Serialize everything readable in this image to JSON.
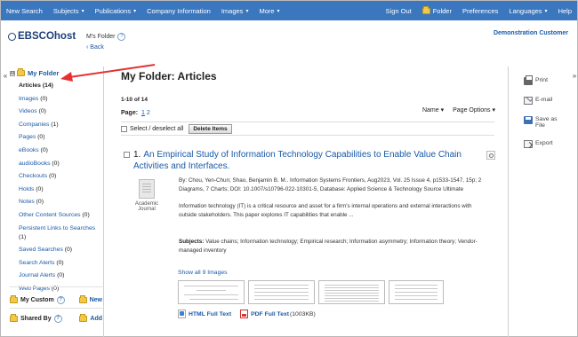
{
  "topnav": {
    "left": [
      {
        "label": "New Search",
        "caret": false
      },
      {
        "label": "Subjects",
        "caret": true
      },
      {
        "label": "Publications",
        "caret": true
      },
      {
        "label": "Company Information",
        "caret": false
      },
      {
        "label": "Images",
        "caret": true
      },
      {
        "label": "More",
        "caret": true
      }
    ],
    "right": [
      {
        "label": "Sign Out"
      },
      {
        "label": "Folder",
        "icon": "folder-icon"
      },
      {
        "label": "Preferences"
      },
      {
        "label": "Languages",
        "caret": true
      },
      {
        "label": "Help"
      }
    ]
  },
  "header": {
    "logo": "EBSCOhost",
    "folder_title": "M's Folder",
    "help": "?",
    "back": "Back",
    "institution": "Demonstration Customer"
  },
  "sidebar": {
    "root": "My Folder",
    "expand_symbol": "⊟",
    "items": [
      {
        "label": "Articles",
        "count": "(14)",
        "active": true
      },
      {
        "label": "Images",
        "count": "(0)"
      },
      {
        "label": "Videos",
        "count": "(0)"
      },
      {
        "label": "Companies",
        "count": "(1)"
      },
      {
        "label": "Pages",
        "count": "(0)"
      },
      {
        "label": "eBooks",
        "count": "(0)"
      },
      {
        "label": "audioBooks",
        "count": "(0)"
      },
      {
        "label": "Checkouts",
        "count": "(0)"
      },
      {
        "label": "Holds",
        "count": "(0)"
      },
      {
        "label": "Notes",
        "count": "(0)"
      },
      {
        "label": "Other Content Sources",
        "count": "(0)"
      },
      {
        "label": "Persistent Links to Searches",
        "count": "(1)"
      },
      {
        "label": "Saved Searches",
        "count": "(0)"
      },
      {
        "label": "Search Alerts",
        "count": "(0)"
      },
      {
        "label": "Journal Alerts",
        "count": "(0)"
      },
      {
        "label": "Web Pages",
        "count": "(0)"
      }
    ],
    "my_custom": "My Custom",
    "shared_by": "Shared By",
    "new_label": "New",
    "add_label": "Add"
  },
  "main": {
    "title": "My Folder: Articles",
    "range": "1-10 of 14",
    "page_label": "Page:",
    "pages": [
      "1",
      "2"
    ],
    "sort": "Name",
    "page_options": "Page Options",
    "select_all": "Select / deselect all",
    "delete": "Delete Items"
  },
  "result": {
    "number": "1.",
    "title": "An Empirical Study of Information Technology Capabilities to Enable Value Chain Activities and Interfaces.",
    "pubtype": "Academic Journal",
    "meta": "By: Chou, Yen-Chun; Shao, Benjamin B. M.. Information Systems Frontiers, Aug2023, Vol. 25 Issue 4, p1533-1547, 15p; 2 Diagrams, 7 Charts; DOI: 10.1007/s10796-022-10301-5, Database: Applied Science & Technology Source Ultimate",
    "abstract": "Information technology (IT) is a critical resource and asset for a firm's internal operations and external interactions with outside stakeholders. This paper explores IT capabilities that enable ...",
    "subjects_label": "Subjects:",
    "subjects": "Value chains; Information technology; Empirical research; Information asymmetry; Information theory; Vendor-managed inventory",
    "show_images": "Show all 9 Images",
    "html_full_text": "HTML Full Text",
    "pdf_full_text": "PDF Full Text",
    "pdf_size": "(1003KB)"
  },
  "tools": [
    {
      "label": "Print",
      "icon": "print-icon"
    },
    {
      "label": "E-mail",
      "icon": "email-icon"
    },
    {
      "label": "Save as File",
      "icon": "save-icon"
    },
    {
      "label": "Export",
      "icon": "export-icon"
    }
  ],
  "colors": {
    "topbar": "#3a77bf",
    "link": "#1a5aa6",
    "annotation_arrow": "#e53131"
  }
}
